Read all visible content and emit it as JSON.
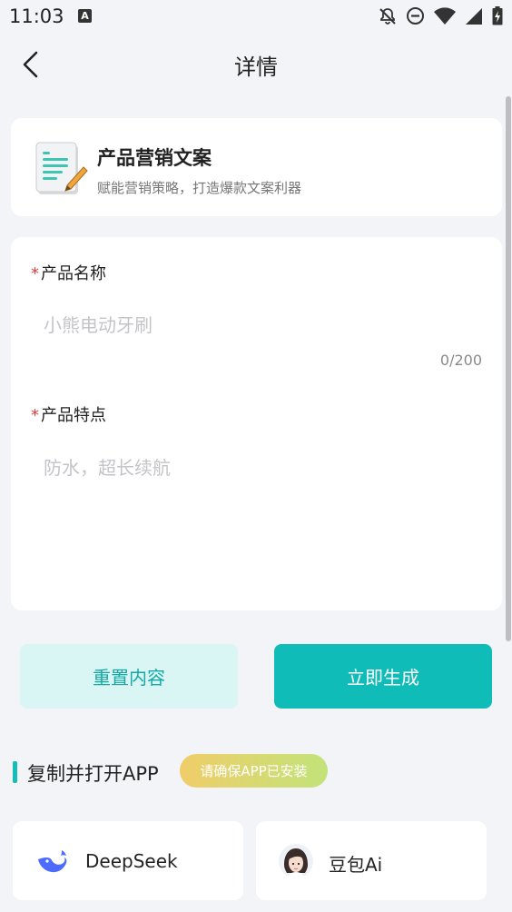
{
  "status_bar": {
    "time": "11:03",
    "badge_letter": "A"
  },
  "nav": {
    "title": "详情"
  },
  "header_card": {
    "title": "产品营销文案",
    "subtitle": "赋能营销策略，打造爆款文案利器"
  },
  "form": {
    "required_mark": "*",
    "field1_label": "产品名称",
    "field1_placeholder": "小熊电动牙刷",
    "field1_counter": "0/200",
    "field2_label": "产品特点",
    "field2_placeholder": "防水，超长续航"
  },
  "buttons": {
    "reset": "重置内容",
    "generate": "立即生成"
  },
  "section": {
    "title": "复制并打开APP",
    "badge": "请确保APP已安装"
  },
  "apps": [
    {
      "name": "DeepSeek",
      "icon": "deepseek-whale-icon"
    },
    {
      "name": "豆包Ai",
      "icon": "doubao-avatar-icon"
    }
  ],
  "colors": {
    "accent": "#0fbcb8",
    "accent_light": "#d9f5f4",
    "required": "#e04040",
    "background": "#f3f4f8"
  }
}
